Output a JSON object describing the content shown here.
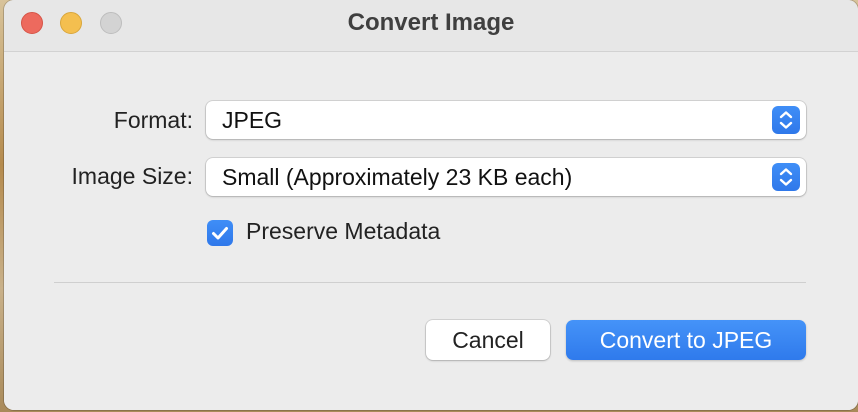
{
  "window": {
    "title": "Convert Image",
    "traffic_lights": [
      "close",
      "minimize",
      "zoom"
    ]
  },
  "form": {
    "format_label": "Format:",
    "format_value": "JPEG",
    "size_label": "Image Size:",
    "size_value": "Small (Approximately 23 KB each)",
    "preserve_metadata_label": "Preserve Metadata",
    "preserve_metadata_checked": true
  },
  "buttons": {
    "cancel": "Cancel",
    "convert": "Convert to JPEG"
  },
  "icons": {
    "popup_stepper": "up-down-chevron-icon",
    "checkbox": "checkmark-icon"
  },
  "colors": {
    "accent": "#2f7aec",
    "close": "#ed6a5e",
    "minimize": "#f4bf4f",
    "zoom_inactive": "#d3d3d3"
  }
}
